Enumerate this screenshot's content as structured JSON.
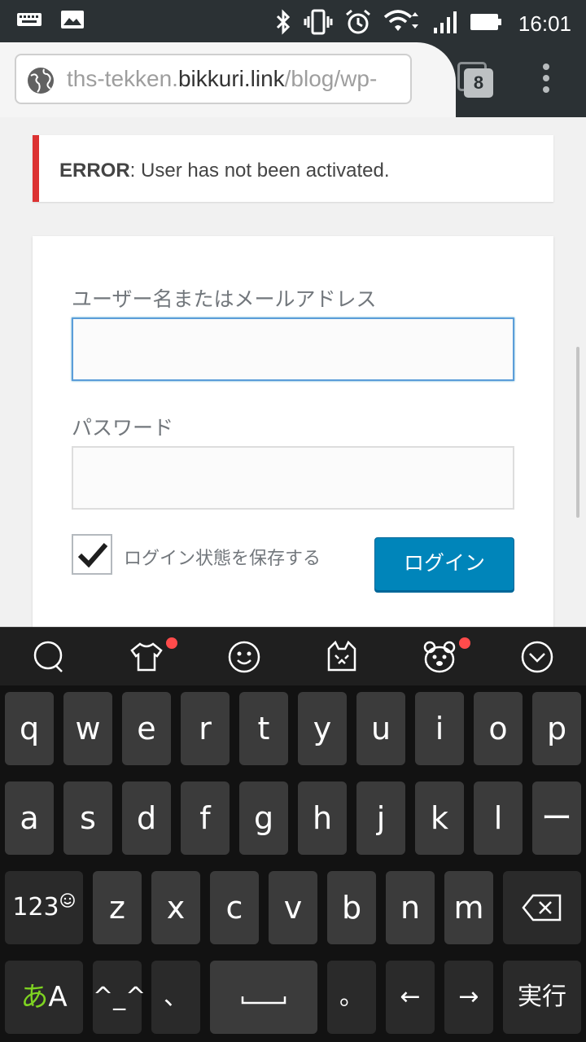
{
  "status_bar": {
    "time": "16:01",
    "icons": [
      "keyboard-icon",
      "image-icon",
      "bluetooth-icon",
      "vibrate-icon",
      "alarm-icon",
      "wifi-icon",
      "signal-icon",
      "battery-icon"
    ]
  },
  "browser": {
    "url_prefix": "ths-tekken.",
    "url_domain": "bikkuri.link",
    "url_path": "/blog/wp-",
    "tab_count": "8"
  },
  "error": {
    "label": "ERROR",
    "message": ": User has not been activated."
  },
  "login_form": {
    "username_label": "ユーザー名またはメールアドレス",
    "username_value": "",
    "password_label": "パスワード",
    "password_value": "",
    "remember_label": "ログイン状態を保存する",
    "remember_checked": true,
    "submit_label": "ログイン"
  },
  "keyboard": {
    "toolbar_icons": [
      "speech-bubble-icon",
      "shirt-icon",
      "smiley-icon",
      "cat-face-icon",
      "bear-face-icon",
      "collapse-icon"
    ],
    "row1": [
      "q",
      "w",
      "e",
      "r",
      "t",
      "y",
      "u",
      "i",
      "o",
      "p"
    ],
    "row2": [
      "a",
      "s",
      "d",
      "f",
      "g",
      "h",
      "j",
      "k",
      "l",
      "ー"
    ],
    "row3": [
      "z",
      "x",
      "c",
      "v",
      "b",
      "n",
      "m"
    ],
    "key_123": "123",
    "key_lang_kana": "あ",
    "key_lang_latin": "A",
    "key_emoticon": "^_^",
    "key_comma": "、",
    "key_period": "。",
    "key_left": "←",
    "key_right": "→",
    "key_enter": "実行",
    "accent_color": "#7ed321"
  },
  "colors": {
    "error_border": "#dc3232",
    "button_blue": "#0085ba",
    "status_bar": "#2b3134"
  }
}
